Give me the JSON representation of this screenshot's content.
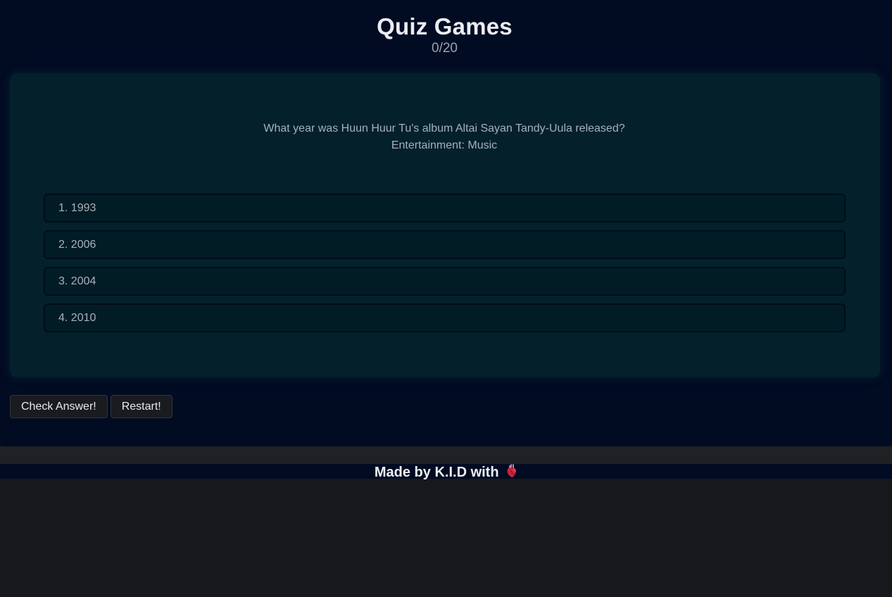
{
  "header": {
    "title": "Quiz Games",
    "score": "0/20"
  },
  "question": {
    "text": "What year was Huun Huur Tu's album Altai Sayan Tandy-Uula released?",
    "category": "Entertainment: Music"
  },
  "options": [
    {
      "label": "1. 1993"
    },
    {
      "label": "2. 2006"
    },
    {
      "label": "3. 2004"
    },
    {
      "label": "4. 2010"
    }
  ],
  "actions": {
    "check_label": "Check Answer!",
    "restart_label": "Restart!"
  },
  "footer": {
    "text": "Made by K.I.D with",
    "icon": "anatomical-heart-icon"
  },
  "colors": {
    "background": "#010b22",
    "card": "#03202b",
    "option_bg": "#021c25"
  }
}
